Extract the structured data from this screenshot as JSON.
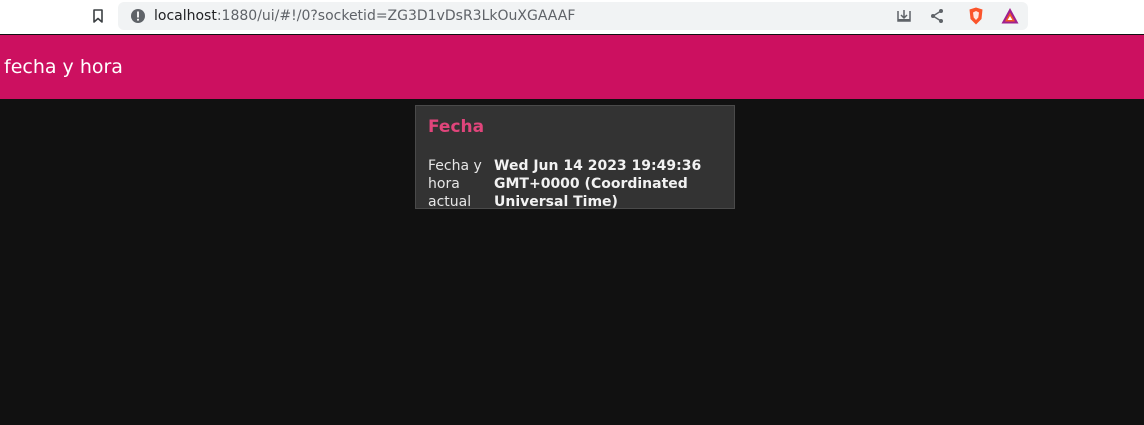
{
  "browser": {
    "url_host": "localhost",
    "url_rest": ":1880/ui/#!/0?socketid=ZG3D1vDsR3LkOuXGAAAF",
    "icons": [
      "bookmark-icon",
      "site-info-icon",
      "install-icon",
      "share-icon",
      "brave-shields-icon",
      "brave-rewards-icon"
    ]
  },
  "header": {
    "title": "fecha y hora",
    "color": "#cc1060"
  },
  "card": {
    "title": "Fecha",
    "title_color": "#e0457b",
    "label": "Fecha y hora actual",
    "value": "Wed Jun 14 2023 19:49:36 GMT+0000 (Coordinated Universal Time)"
  }
}
